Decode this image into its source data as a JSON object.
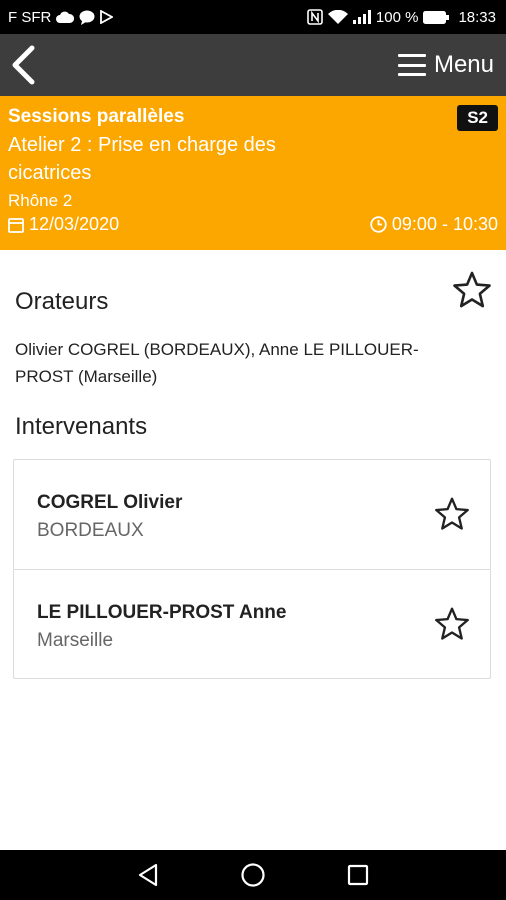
{
  "status_bar": {
    "carrier": "F SFR",
    "battery": "100 %",
    "time": "18:33",
    "icons_left": [
      "cloud-icon",
      "chat-icon",
      "play-store-icon"
    ],
    "icons_right": [
      "nfc-icon",
      "wifi-icon",
      "signal-icon",
      "battery-icon"
    ]
  },
  "app_bar": {
    "menu_label": "Menu",
    "back_icon": "chevron-left-icon",
    "menu_icon": "hamburger-icon"
  },
  "session": {
    "type": "Sessions parallèles",
    "title": "Atelier 2 : Prise en charge des cicatrices",
    "room": "Rhône 2",
    "code": "S2",
    "date": "12/03/2020",
    "time": "09:00 - 10:30",
    "background_color": "#fca600"
  },
  "orateurs": {
    "title": "Orateurs",
    "text": "Olivier COGREL (BORDEAUX), Anne LE PILLOUER-PROST (Marseille)"
  },
  "intervenants": {
    "title": "Intervenants",
    "items": [
      {
        "name": "COGREL Olivier",
        "city": "BORDEAUX"
      },
      {
        "name": "LE PILLOUER-PROST Anne",
        "city": "Marseille"
      }
    ]
  },
  "nav_bar": {
    "icons": [
      "back-triangle-icon",
      "home-circle-icon",
      "recents-square-icon"
    ]
  }
}
